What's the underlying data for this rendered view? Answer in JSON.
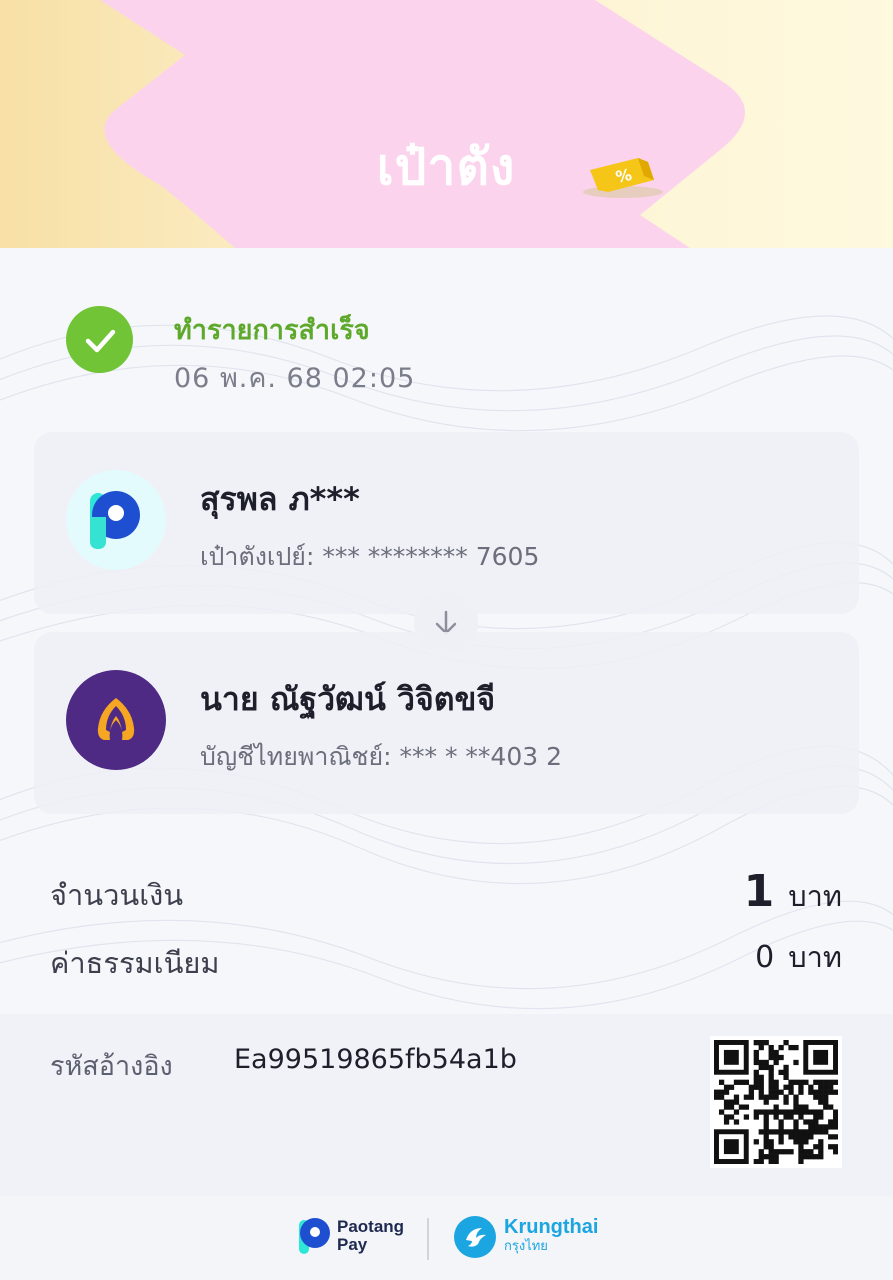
{
  "banner": {
    "title": "เป๋าตัง",
    "icon": "coupon-percent-icon"
  },
  "status": {
    "title": "ทำรายการสำเร็จ",
    "datetime": "06 พ.ค. 68 02:05",
    "icon": "check-icon",
    "color": "#70c435"
  },
  "sender": {
    "name": "สุรพล ภ***",
    "account": "เป๋าตังเปย์: *** ******** 7605",
    "logo": "paotang-logo"
  },
  "receiver": {
    "name": "นาย ณัฐวัฒน์ วิจิตขจี",
    "account": "บัญชีไทยพาณิชย์: *** * **403 2",
    "logo": "scb-logo"
  },
  "transfer_arrow": "arrow-down-icon",
  "amount": {
    "label": "จำนวนเงิน",
    "value": "1",
    "unit": "บาท"
  },
  "fee": {
    "label": "ค่าธรรมเนียม",
    "value": "0",
    "unit": "บาท"
  },
  "reference": {
    "label": "รหัสอ้างอิง",
    "value": "Ea99519865fb54a1b"
  },
  "footer": {
    "paotang_line1": "Paotang",
    "paotang_line2": "Pay",
    "ktb_en": "Krungthai",
    "ktb_th": "กรุงไทย"
  },
  "colors": {
    "success": "#70c435",
    "banner_pink": "#fcd3ec",
    "scb_purple": "#4e2a84",
    "ktb_blue": "#1ba5e1"
  }
}
